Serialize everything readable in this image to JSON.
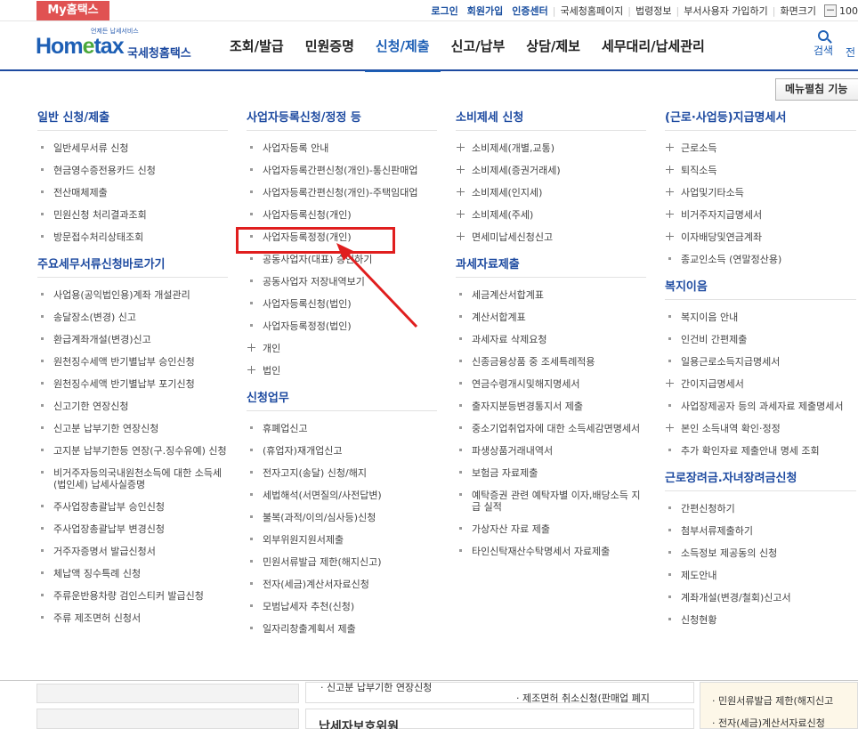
{
  "topbar": {
    "my_tab": "My홈택스",
    "links": [
      "로그인",
      "회원가입",
      "인증센터",
      "국세청홈페이지",
      "법령정보",
      "부서사용자 가입하기",
      "화면크기"
    ],
    "zoom_minus": "－",
    "zoom_value": "100"
  },
  "header": {
    "logo_small": "언제든 납세서비스",
    "logo_home": "Hom",
    "logo_e": "e",
    "logo_tax": "tax",
    "logo_kr": "국세청홈택스",
    "nav": [
      "조회/발급",
      "민원증명",
      "신청/제출",
      "신고/납부",
      "상담/제보",
      "세무대리/납세관리"
    ],
    "active_nav": "신청/제출",
    "search_label": "검색",
    "more_label": "전"
  },
  "panel": {
    "close_label": "메뉴펼침 기능",
    "columns": [
      {
        "sections": [
          {
            "title": "일반 신청/제출",
            "items": [
              "일반세무서류 신청",
              "현금영수증전용카드 신청",
              "전산매체제출",
              "민원신청 처리결과조회",
              "방문접수처리상태조회"
            ]
          },
          {
            "title": "주요세무서류신청바로가기",
            "items": [
              "사업용(공익법인용)계좌 개설관리",
              "송달장소(변경) 신고",
              "환급계좌개설(변경)신고",
              "원천징수세액 반기별납부 승인신청",
              "원천징수세액 반기별납부 포기신청",
              "신고기한 연장신청",
              "신고분 납부기한 연장신청",
              "고지분 납부기한등 연장(구.징수유예) 신청",
              "비거주자등의국내원천소득에 대한 소득세(법인세) 납세사실증명",
              "주사업장총괄납부 승인신청",
              "주사업장총괄납부 변경신청",
              "거주자증명서 발급신청서",
              "체납액 징수특례 신청",
              "주류운반용차량 검인스티커 발급신청",
              "주류 제조면허 신청서"
            ]
          }
        ]
      },
      {
        "sections": [
          {
            "title": "사업자등록신청/정정 등",
            "items": [
              "사업자등록 안내",
              "사업자등록간편신청(개인)-통신판매업",
              "사업자등록간편신청(개인)-주택임대업",
              "사업자등록신청(개인)",
              "사업자등록정정(개인)",
              "공동사업자(대표) 승인하기",
              "공동사업자 저장내역보기",
              "사업자등록신청(법인)",
              "사업자등록정정(법인)",
              "+개인",
              "+법인"
            ]
          },
          {
            "title": "신청업무",
            "items": [
              "휴폐업신고",
              "(휴업자)재개업신고",
              "전자고지(송달) 신청/해지",
              "세법해석(서면질의/사전답변)",
              "불복(과적/이의/심사등)신청",
              "외부위원지원서제출",
              "민원서류발급 제한(해지신고)",
              "전자(세금)계산서자료신청",
              "모범납세자 추천(신청)",
              "일자리창출계획서 제출"
            ]
          }
        ]
      },
      {
        "sections": [
          {
            "title": "소비제세 신청",
            "items": [
              "+소비제세(개별,교통)",
              "+소비제세(증권거래세)",
              "+소비제세(인지세)",
              "+소비제세(주세)",
              "+면세미납세신청신고"
            ]
          },
          {
            "title": "과세자료제출",
            "items": [
              "세금계산서합계표",
              "계산서합계표",
              "과세자료 삭제요청",
              "신종금융상품 중 조세특례적용",
              "연금수령개시및해지명세서",
              "출자지분등변경통지서 제출",
              "중소기업취업자에 대한 소득세감면명세서",
              "파생상품거래내역서",
              "보험금 자료제출",
              "예탁증권 관련 예탁자별 이자,배당소득 지급 실적",
              "가상자산 자료 제출",
              "타인신탁재산수탁명세서 자료제출"
            ]
          }
        ]
      },
      {
        "sections": [
          {
            "title": "(근로·사업등)지급명세서",
            "items": [
              "+근로소득",
              "+퇴직소득",
              "+사업및기타소득",
              "+비거주자지급명세서",
              "+이자배당및연금계좌",
              "종교인소득 (연말정산용)"
            ]
          },
          {
            "title": "복지이음",
            "items": [
              "복지이음 안내",
              "인건비 간편제출",
              "일용근로소득지급명세서",
              "+간이지급명세서",
              "사업장제공자 등의 과세자료 제출명세서",
              "+본인 소득내역 확인·정정",
              "추가 확인자료 제출안내 명세 조회"
            ]
          },
          {
            "title": "근로장려금.자녀장려금신청",
            "items": [
              "간편신청하기",
              "첨부서류제출하기",
              "소득정보 제공동의 신청",
              "제도안내",
              "계좌개설(변경/철회)신고서",
              "신청현황"
            ]
          }
        ]
      }
    ]
  },
  "behind": {
    "text1": "· 신고분 납부기한 연장신청",
    "text2": "· 제조면허 취소신청(판매업 폐지",
    "text3": "· 민원서류발급 제한(해지신고",
    "text4": "· 전자(세금)계산서자료신청",
    "text5": "납세자보호위원"
  },
  "annotation": {
    "color": "#e01e1e"
  }
}
